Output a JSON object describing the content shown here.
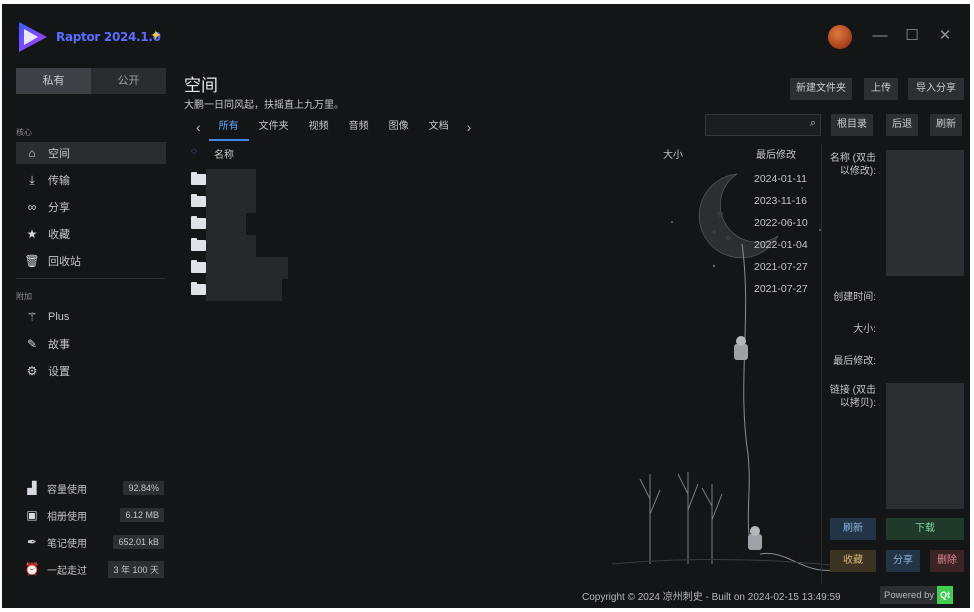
{
  "app": {
    "title": "Raptor 2024.1.0",
    "window_controls": [
      "—",
      "☐",
      "✕"
    ]
  },
  "sidebar": {
    "segment": [
      "私有",
      "公开"
    ],
    "group_core": "核心",
    "core_items": [
      {
        "label": "空间",
        "icon": "home-icon"
      },
      {
        "label": "传输",
        "icon": "download-icon"
      },
      {
        "label": "分享",
        "icon": "link-icon"
      },
      {
        "label": "收藏",
        "icon": "star-icon"
      },
      {
        "label": "回收站",
        "icon": "trash-icon"
      }
    ],
    "group_extra": "附加",
    "extra_items": [
      {
        "label": "Plus",
        "icon": "magic-wand-icon"
      },
      {
        "label": "故事",
        "icon": "feather-icon"
      },
      {
        "label": "设置",
        "icon": "gear-icon"
      }
    ],
    "stats": [
      {
        "label": "容量使用",
        "value": "92.84%",
        "icon": "bar-chart-icon"
      },
      {
        "label": "相册使用",
        "value": "6.12 MB",
        "icon": "image-icon"
      },
      {
        "label": "笔记使用",
        "value": "652.01 kB",
        "icon": "pen-icon"
      },
      {
        "label": "一起走过",
        "value": "3 年 100 天",
        "icon": "alarm-clock-icon"
      }
    ]
  },
  "main": {
    "title": "空间",
    "subtitle": "大鹏一日同风起，扶摇直上九万里。",
    "toolbar": {
      "new_folder": "新建文件夹",
      "upload": "上传",
      "import_share": "导入分享"
    },
    "tabs": [
      "所有",
      "文件夹",
      "视频",
      "音频",
      "图像",
      "文档"
    ],
    "nav_buttons": {
      "root": "根目录",
      "back": "后退",
      "refresh": "刷新"
    },
    "columns": {
      "name": "名称",
      "size": "大小",
      "modified": "最后修改"
    },
    "rows": [
      {
        "modified": "2024-01-11"
      },
      {
        "modified": "2023-11-16"
      },
      {
        "modified": "2022-06-10"
      },
      {
        "modified": "2022-01-04"
      },
      {
        "modified": "2021-07-27"
      },
      {
        "modified": "2021-07-27"
      }
    ]
  },
  "details": {
    "name_label": "名称 (双击以修改):",
    "created_label": "创建时间:",
    "size_label": "大小:",
    "modified_label": "最后修改:",
    "link_label": "链接 (双击以拷贝):",
    "refresh": "刷新",
    "download": "下载",
    "favorite": "收藏",
    "share": "分享",
    "delete": "删除"
  },
  "footer": {
    "copyright": "Copyright © 2024 凉州刺史 - Built on 2024-02-15 13:49:59",
    "powered_by": "Powered by",
    "qt": "Qt"
  }
}
